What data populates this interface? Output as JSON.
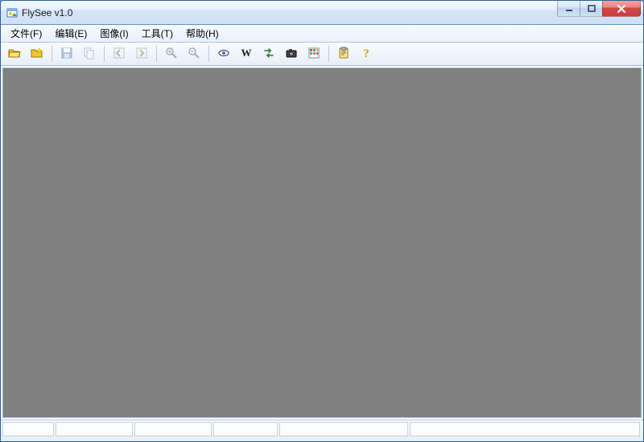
{
  "titlebar": {
    "title": "FlySee v1.0"
  },
  "menus": {
    "file": "文件(F)",
    "edit": "编辑(E)",
    "image": "图像(I)",
    "tools": "工具(T)",
    "help": "帮助(H)"
  },
  "toolbar_icons": {
    "open": "open-icon",
    "new": "new-folder-icon",
    "save": "save-icon",
    "copy": "copy-icon",
    "prev": "prev-icon",
    "next": "next-icon",
    "zoom_in": "zoom-in-icon",
    "zoom_out": "zoom-out-icon",
    "eye": "eye-icon",
    "w": "w-icon",
    "convert": "convert-icon",
    "camera": "camera-icon",
    "palette": "palette-icon",
    "clipboard": "clipboard-icon",
    "help": "help-icon"
  }
}
